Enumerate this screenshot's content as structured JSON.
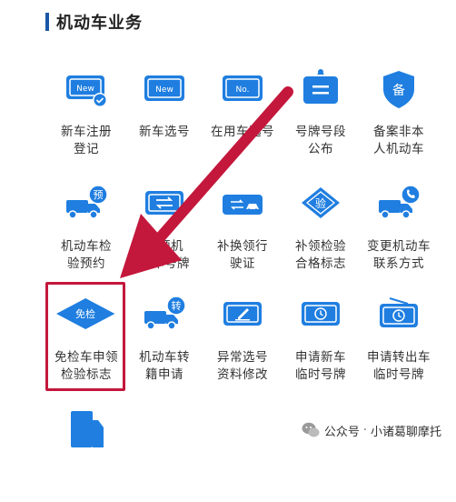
{
  "section": {
    "title": "机动车业务"
  },
  "tiles": [
    {
      "label": "新车注册\n登记",
      "icon": "new-plate-check-icon"
    },
    {
      "label": "新车选号",
      "icon": "new-plate-icon"
    },
    {
      "label": "在用车选号",
      "icon": "no-plate-icon"
    },
    {
      "label": "号牌号段\n公布",
      "icon": "sign-board-icon"
    },
    {
      "label": "备案非本\n人机动车",
      "icon": "shield-bei-icon"
    },
    {
      "label": "机动车检\n验预约",
      "icon": "truck-yu-icon"
    },
    {
      "label": "补领机\n动车号牌",
      "icon": "plate-swap-icon"
    },
    {
      "label": "补换领行\n驶证",
      "icon": "car-swap-icon"
    },
    {
      "label": "补领检验\n合格标志",
      "icon": "diamond-yan-icon"
    },
    {
      "label": "变更机动车\n联系方式",
      "icon": "truck-phone-icon"
    },
    {
      "label": "免检车申领\n检验标志",
      "icon": "diamond-mianjian-icon"
    },
    {
      "label": "机动车转\n籍申请",
      "icon": "truck-zhuan-icon"
    },
    {
      "label": "异常选号\n资料修改",
      "icon": "plate-edit-icon"
    },
    {
      "label": "申请新车\n临时号牌",
      "icon": "temp-plate-clock-icon"
    },
    {
      "label": "申请转出车\n临时号牌",
      "icon": "temp-plate-out-icon"
    },
    {
      "label": "",
      "icon": "truck-partial-icon"
    }
  ],
  "watermark": {
    "platform": "公众号",
    "sep": "·",
    "name": "小诸葛聊摩托"
  },
  "colors": {
    "accent": "#1f7ee0",
    "highlight": "#c4173c",
    "section_bar": "#1a57a8"
  }
}
